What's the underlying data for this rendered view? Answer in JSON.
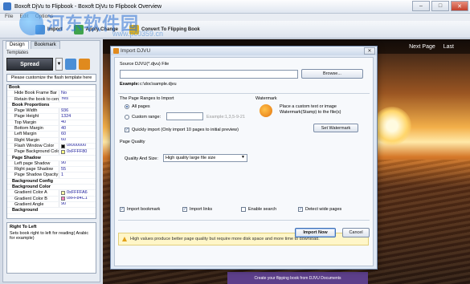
{
  "window": {
    "title": "Boxoft DjVu to Flipbook - Boxoft DjVu to Flipbook Overview",
    "minimize": "–",
    "maximize": "□",
    "close": "✕"
  },
  "menu": {
    "items": [
      "File",
      "Edit",
      "Options"
    ]
  },
  "toolbar": {
    "items": [
      "Import",
      "Apply Change",
      "Convert To Flipping Book"
    ],
    "accent": "#e08a1e"
  },
  "watermark": {
    "text": "河东软件园",
    "url": "www.pc0359.cn"
  },
  "left_panel": {
    "tabs": [
      "Design",
      "Bookmark"
    ],
    "templates_label": "Templates",
    "template_name": "Spread",
    "dropdown_arrow": "▼",
    "customize_text": "Please customize the flash template here",
    "properties": [
      {
        "name": "Book",
        "value": "",
        "group": true
      },
      {
        "name": "Hide Book Frame Bar",
        "value": "No"
      },
      {
        "name": "Retain the book to center",
        "value": "Yes"
      },
      {
        "name": "Book Proportions",
        "value": "",
        "group": true,
        "sub": true
      },
      {
        "name": "Page Width",
        "value": "936"
      },
      {
        "name": "Page Height",
        "value": "1324"
      },
      {
        "name": "Top Margin",
        "value": "40"
      },
      {
        "name": "Bottom Margin",
        "value": "40"
      },
      {
        "name": "Left Margin",
        "value": "60"
      },
      {
        "name": "Right Margin",
        "value": "60"
      },
      {
        "name": "Flash Window Color",
        "value": "0x000000",
        "swatch": "#000000"
      },
      {
        "name": "Page Background Color",
        "value": "0xFFFF80",
        "swatch": "#ffff80"
      },
      {
        "name": "Page Shadow",
        "value": "",
        "group": true,
        "sub": true
      },
      {
        "name": "Left page Shadow",
        "value": "90"
      },
      {
        "name": "Right page Shadow",
        "value": "55"
      },
      {
        "name": "Page Shadow Opacity",
        "value": "1"
      },
      {
        "name": "Background Config",
        "value": "",
        "group": true,
        "sub": true
      },
      {
        "name": "Background Color",
        "value": "",
        "group": true,
        "sub": true
      },
      {
        "name": "Gradient Color A",
        "value": "0xFFFFA6",
        "swatch": "#ffffa6"
      },
      {
        "name": "Gradient Color B",
        "value": "0xFF84C1",
        "swatch": "#ff84c1"
      },
      {
        "name": "Gradient Angle",
        "value": "90"
      },
      {
        "name": "Background",
        "value": "",
        "group": true,
        "sub": true
      }
    ],
    "description_title": "Right To Left",
    "description_text": "Sets book right to left for reading( Arabic for example)"
  },
  "preview": {
    "nav": [
      "Next Page",
      "Last"
    ],
    "book_caption": "Create your flipping book from DJVU Documents"
  },
  "dialog": {
    "title": "Import DJVU",
    "close": "✕",
    "source_label": "Source DJVU(*.djvu) File",
    "browse": "Browse...",
    "example_label": "Example:",
    "example_value": "c:\\doc\\sample.djvu",
    "ranges_title": "The Page Ranges to Import",
    "all_pages": "All pages",
    "custom_range": "Custom range:",
    "custom_range_hint": "Example:1,3,5-9-21",
    "quick_import": "Quickly import (Only import 10 pages to  initial  preview)",
    "watermark_title": "Watermark",
    "watermark_desc": "Place a custom text or image Watermark(Stamp) to the file(s)",
    "set_watermark": "Set Watermark",
    "quality_title": "Page Quality",
    "quality_label": "Quality And Size:",
    "quality_value": "High quality large file size",
    "notice": "High values produce better page quality but require more disk space and more time to download.",
    "opt_bookmark": "Import bookmark",
    "opt_links": "Import links",
    "opt_search": "Enable search",
    "opt_wide": "Detect wide pages",
    "import_now": "Import Now",
    "cancel": "Cancel"
  }
}
